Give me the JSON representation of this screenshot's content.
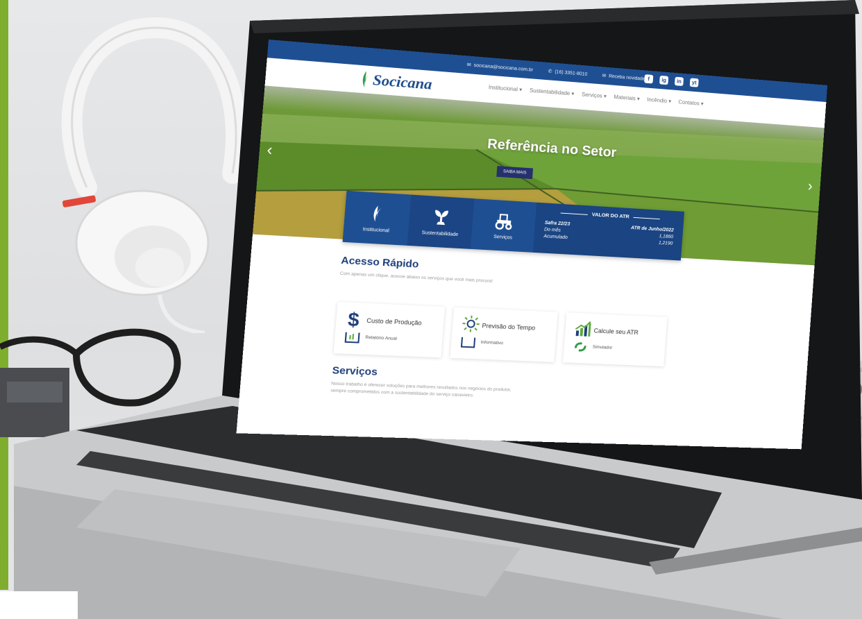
{
  "topbar": {
    "email": "socicana@socicana.com.br",
    "phone": "(16) 3351-8010",
    "newsletter": "Receba novidades",
    "socials": [
      "f",
      "ig",
      "in",
      "yt"
    ]
  },
  "navbar": {
    "logo_text": "Socicana",
    "menu": [
      "Institucional ▾",
      "Sustentabilidade ▾",
      "Serviços ▾",
      "Materiais ▾",
      "Incêndio ▾",
      "Contatos ▾"
    ]
  },
  "hero": {
    "title": "Referência no Setor",
    "button_label": "SAIBA MAIS",
    "prev_arrow": "‹",
    "next_arrow": "›"
  },
  "tiles": [
    {
      "label": "Institucional",
      "icon": "leaf-icon"
    },
    {
      "label": "Sustentabilidade",
      "icon": "sprout-icon"
    },
    {
      "label": "Serviços",
      "icon": "tractor-icon"
    }
  ],
  "atr": {
    "title": "VALOR DO ATR",
    "safra_label": "Safra 22/23",
    "month_label": "ATR de Junho/2022",
    "row1_label": "Do mês",
    "row1_value": "1,1860",
    "row2_label": "Acumulado",
    "row2_value": "1,2190"
  },
  "quick_access": {
    "title": "Acesso Rápido",
    "subtitle": "Com apenas um clique, acesse abaixo os serviços que você mais procura!",
    "cards": [
      {
        "title": "Custo de Produção",
        "subtitle": "Relatório Anual"
      },
      {
        "title": "Previsão do Tempo",
        "subtitle": "Informativo"
      },
      {
        "title": "Calcule seu ATR",
        "subtitle": "Simulador"
      }
    ]
  },
  "services": {
    "title": "Serviços",
    "text_line1": "Nosso trabalho é oferecer soluções para melhores resultados nos negócios do produtor,",
    "text_line2": "sempre comprometidos com a sustentabilidade do serviço canavieiro."
  },
  "colors": {
    "brand_blue": "#1f4f93",
    "accent_green": "#7fae2e",
    "heading_blue": "#1f3f7a"
  }
}
